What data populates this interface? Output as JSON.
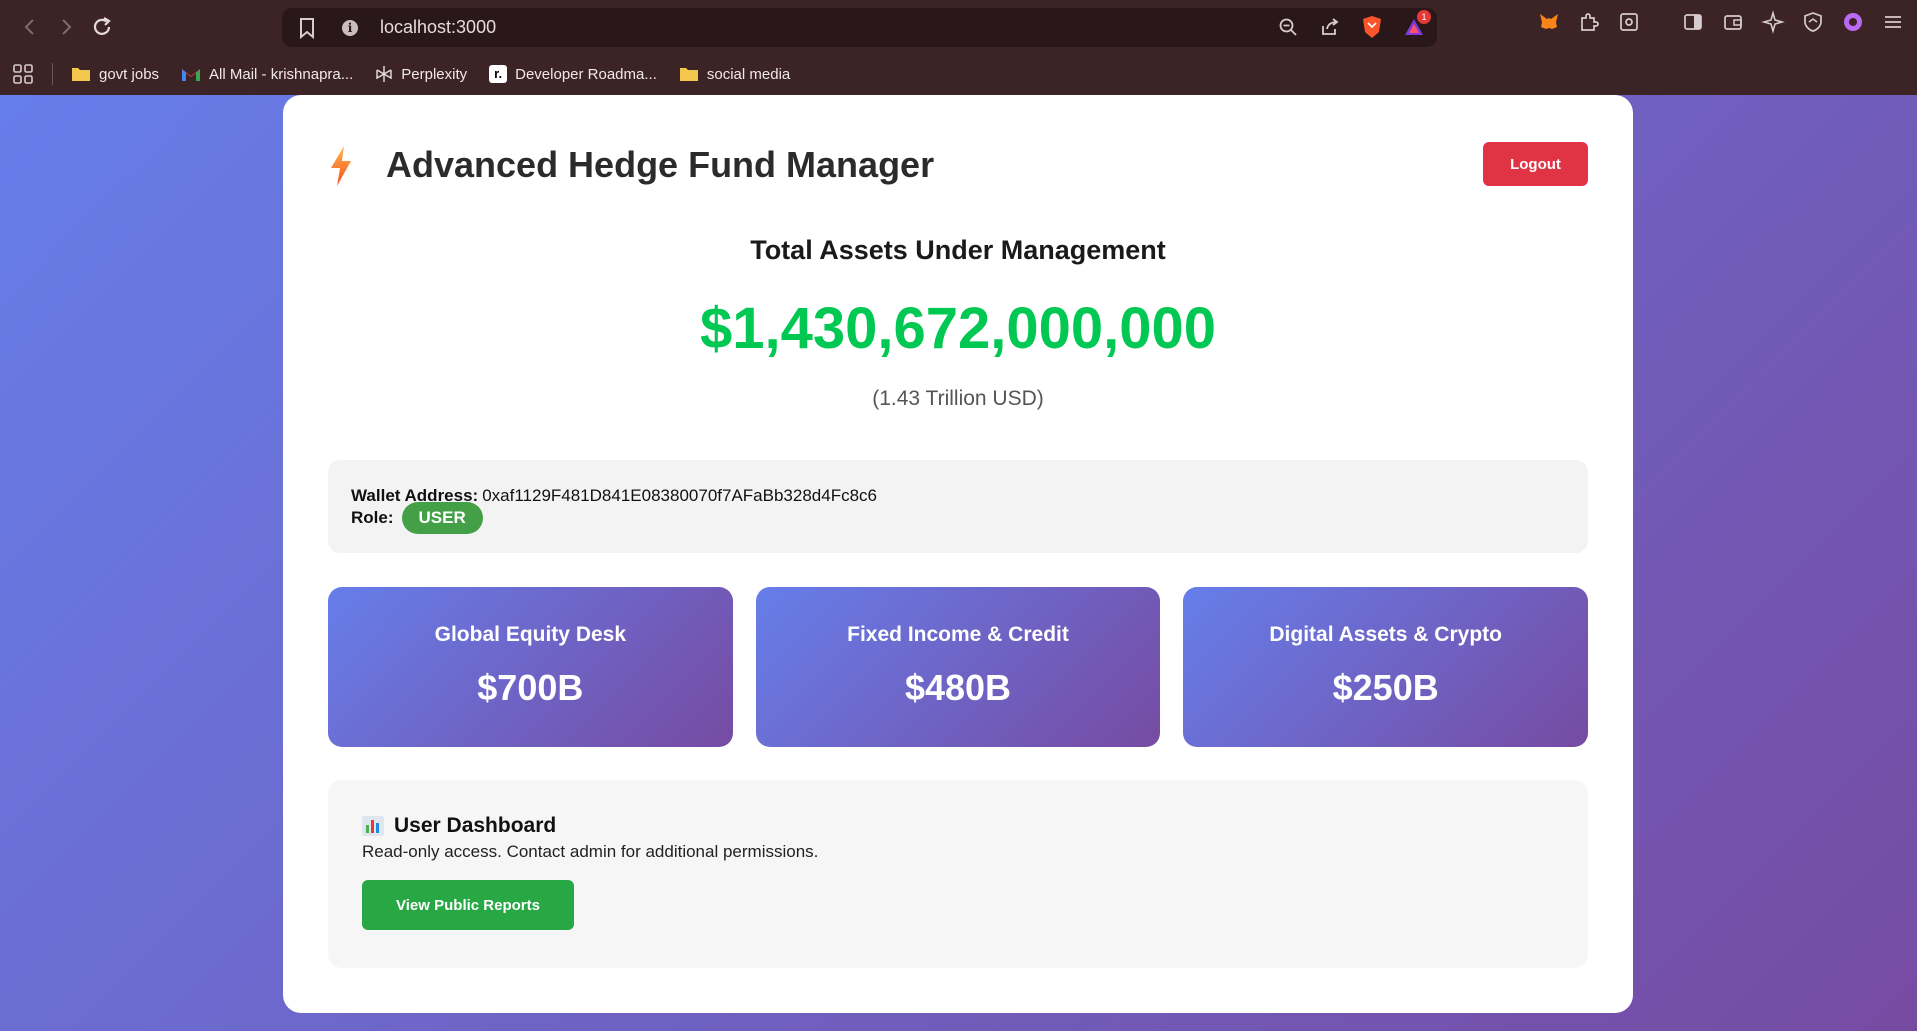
{
  "browser": {
    "url": "localhost:3000",
    "notification_count": "1",
    "bookmarks": [
      {
        "label": "govt jobs",
        "icon": "folder-icon"
      },
      {
        "label": "All Mail - krishnapra...",
        "icon": "gmail-icon"
      },
      {
        "label": "Perplexity",
        "icon": "perplexity-icon"
      },
      {
        "label": "Developer Roadma...",
        "icon": "roadmap-icon"
      },
      {
        "label": "social media",
        "icon": "folder-icon"
      }
    ]
  },
  "app": {
    "title": "Advanced Hedge Fund Manager",
    "logout_label": "Logout",
    "accent_color": "#00c853",
    "logout_color": "#e03444"
  },
  "aum": {
    "label": "Total Assets Under Management",
    "value": "$1,430,672,000,000",
    "subtitle": "(1.43 Trillion USD)"
  },
  "wallet": {
    "address_label": "Wallet Address:",
    "address": "0xaf1129F481D841E08380070f7AFaBb328d4Fc8c6",
    "role_label": "Role:",
    "role": "USER"
  },
  "desks": [
    {
      "name": "Global Equity Desk",
      "value": "$700B"
    },
    {
      "name": "Fixed Income & Credit",
      "value": "$480B"
    },
    {
      "name": "Digital Assets & Crypto",
      "value": "$250B"
    }
  ],
  "dashboard": {
    "title": "User Dashboard",
    "description": "Read-only access. Contact admin for additional permissions.",
    "button_label": "View Public Reports"
  }
}
